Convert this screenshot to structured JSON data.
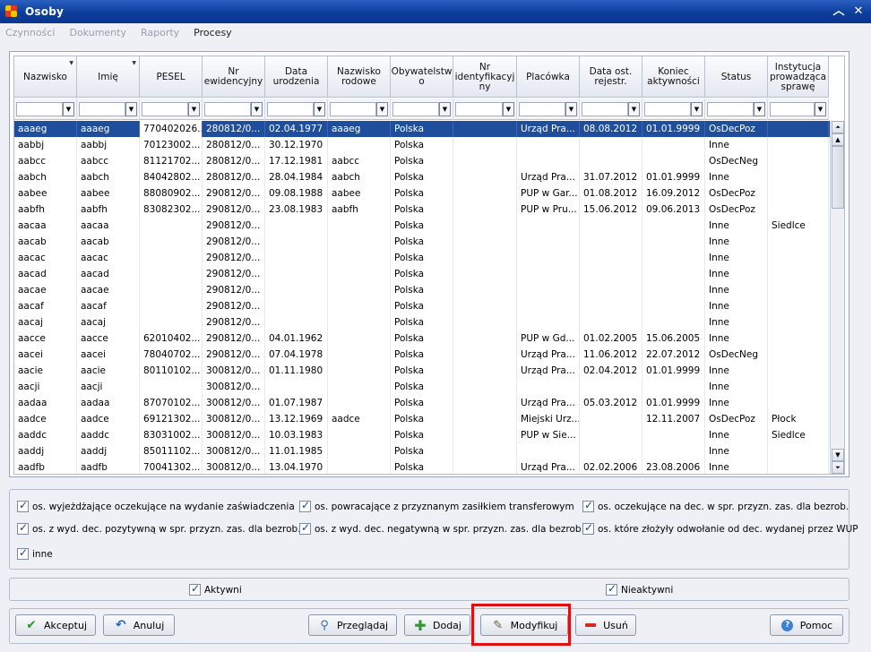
{
  "window": {
    "title": "Osoby"
  },
  "menu": [
    {
      "label": "Czynności",
      "active": false
    },
    {
      "label": "Dokumenty",
      "active": false
    },
    {
      "label": "Raporty",
      "active": false
    },
    {
      "label": "Procesy",
      "active": true
    }
  ],
  "grid": {
    "columns": [
      "Nazwisko",
      "Imię",
      "PESEL",
      "Nr ewidencyjny",
      "Data urodzenia",
      "Nazwisko rodowe",
      "Obywatelstwo",
      "Nr identyfikacyjny",
      "Placówka",
      "Data ost. rejestr.",
      "Koniec aktywności",
      "Status",
      "Instytucja prowadząca sprawę"
    ],
    "column_header_lines": [
      [
        "Nazwisko"
      ],
      [
        "Imię"
      ],
      [
        "PESEL"
      ],
      [
        "Nr",
        "ewidencyjny"
      ],
      [
        "Data",
        "urodzenia"
      ],
      [
        "Nazwisko",
        "rodowe"
      ],
      [
        "Obywatelstw",
        "o"
      ],
      [
        "Nr",
        "identyfikacyj",
        "ny"
      ],
      [
        "Placówka"
      ],
      [
        "Data ost.",
        "rejestr."
      ],
      [
        "Koniec",
        "aktywności"
      ],
      [
        "Status"
      ],
      [
        "Instytucja",
        "prowadząca",
        "sprawę"
      ]
    ],
    "rows": [
      [
        "aaaeg",
        "aaaeg",
        "770402026...",
        "280812/0...",
        "02.04.1977",
        "aaaeg",
        "Polska",
        "",
        "Urząd Pra...",
        "08.08.2012",
        "01.01.9999",
        "OsDecPoz",
        ""
      ],
      [
        "aabbj",
        "aabbj",
        "70123002...",
        "280812/0...",
        "30.12.1970",
        "",
        "Polska",
        "",
        "",
        "",
        "",
        "Inne",
        ""
      ],
      [
        "aabcc",
        "aabcc",
        "81121702...",
        "280812/0...",
        "17.12.1981",
        "aabcc",
        "Polska",
        "",
        "",
        "",
        "",
        "OsDecNeg",
        ""
      ],
      [
        "aabch",
        "aabch",
        "84042802...",
        "280812/0...",
        "28.04.1984",
        "aabch",
        "Polska",
        "",
        "Urząd Pra...",
        "31.07.2012",
        "01.01.9999",
        "Inne",
        ""
      ],
      [
        "aabee",
        "aabee",
        "88080902...",
        "290812/0...",
        "09.08.1988",
        "aabee",
        "Polska",
        "",
        "PUP w Gar...",
        "01.08.2012",
        "16.09.2012",
        "OsDecPoz",
        ""
      ],
      [
        "aabfh",
        "aabfh",
        "83082302...",
        "290812/0...",
        "23.08.1983",
        "aabfh",
        "Polska",
        "",
        "PUP w Pru...",
        "15.06.2012",
        "09.06.2013",
        "OsDecPoz",
        ""
      ],
      [
        "aacaa",
        "aacaa",
        "",
        "290812/0...",
        "",
        "",
        "Polska",
        "",
        "",
        "",
        "",
        "Inne",
        "Siedlce"
      ],
      [
        "aacab",
        "aacab",
        "",
        "290812/0...",
        "",
        "",
        "Polska",
        "",
        "",
        "",
        "",
        "Inne",
        ""
      ],
      [
        "aacac",
        "aacac",
        "",
        "290812/0...",
        "",
        "",
        "Polska",
        "",
        "",
        "",
        "",
        "Inne",
        ""
      ],
      [
        "aacad",
        "aacad",
        "",
        "290812/0...",
        "",
        "",
        "Polska",
        "",
        "",
        "",
        "",
        "Inne",
        ""
      ],
      [
        "aacae",
        "aacae",
        "",
        "290812/0...",
        "",
        "",
        "Polska",
        "",
        "",
        "",
        "",
        "Inne",
        ""
      ],
      [
        "aacaf",
        "aacaf",
        "",
        "290812/0...",
        "",
        "",
        "Polska",
        "",
        "",
        "",
        "",
        "Inne",
        ""
      ],
      [
        "aacaj",
        "aacaj",
        "",
        "290812/0...",
        "",
        "",
        "Polska",
        "",
        "",
        "",
        "",
        "Inne",
        ""
      ],
      [
        "aacce",
        "aacce",
        "62010402...",
        "290812/0...",
        "04.01.1962",
        "",
        "Polska",
        "",
        "PUP w Gd...",
        "01.02.2005",
        "15.06.2005",
        "Inne",
        ""
      ],
      [
        "aacei",
        "aacei",
        "78040702...",
        "290812/0...",
        "07.04.1978",
        "",
        "Polska",
        "",
        "Urząd Pra...",
        "11.06.2012",
        "22.07.2012",
        "OsDecNeg",
        ""
      ],
      [
        "aacie",
        "aacie",
        "80110102...",
        "300812/0...",
        "01.11.1980",
        "",
        "Polska",
        "",
        "Urząd Pra...",
        "02.04.2012",
        "01.01.9999",
        "Inne",
        ""
      ],
      [
        "aacji",
        "aacji",
        "",
        "300812/0...",
        "",
        "",
        "Polska",
        "",
        "",
        "",
        "",
        "Inne",
        ""
      ],
      [
        "aadaa",
        "aadaa",
        "87070102...",
        "300812/0...",
        "01.07.1987",
        "",
        "Polska",
        "",
        "Urząd Pra...",
        "05.03.2012",
        "01.01.9999",
        "Inne",
        ""
      ],
      [
        "aadce",
        "aadce",
        "69121302...",
        "300812/0...",
        "13.12.1969",
        "aadce",
        "Polska",
        "",
        "Miejski Urz...",
        "",
        "12.11.2007",
        "OsDecPoz",
        "Płock"
      ],
      [
        "aaddc",
        "aaddc",
        "83031002...",
        "300812/0...",
        "10.03.1983",
        "",
        "Polska",
        "",
        "PUP w Sie...",
        "",
        "",
        "Inne",
        "Siedlce"
      ],
      [
        "aaddj",
        "aaddj",
        "85011102...",
        "300812/0...",
        "11.01.1985",
        "",
        "Polska",
        "",
        "",
        "",
        "",
        "Inne",
        ""
      ],
      [
        "aadfb",
        "aadfb",
        "70041302...",
        "300812/0...",
        "13.04.1970",
        "",
        "Polska",
        "",
        "Urząd Pra...",
        "02.02.2006",
        "23.08.2006",
        "Inne",
        ""
      ]
    ],
    "selected_row": 0
  },
  "filters": [
    "os. wyjeżdżające oczekujące na wydanie zaświadczenia",
    "os. powracające z przyznanym zasiłkiem transferowym",
    "os. oczekujące na dec. w spr. przyzn. zas. dla bezrob.",
    "os. z wyd. dec. pozytywną w spr. przyzn. zas. dla bezrob.",
    "os. z wyd. dec. negatywną w spr. przyzn. zas. dla bezrob.",
    "os. które złożyły odwołanie od dec. wydanej przez WUP",
    "inne"
  ],
  "flags": {
    "active": "Aktywni",
    "inactive": "Nieaktywni"
  },
  "buttons": {
    "accept": "Akceptuj",
    "cancel": "Anuluj",
    "browse": "Przeglądaj",
    "add": "Dodaj",
    "modify": "Modyfikuj",
    "delete": "Usuń",
    "help": "Pomoc"
  },
  "colors": {
    "selection": "#1f4f9c",
    "titlebar": "#0c3d9c",
    "highlight": "#e01010"
  }
}
